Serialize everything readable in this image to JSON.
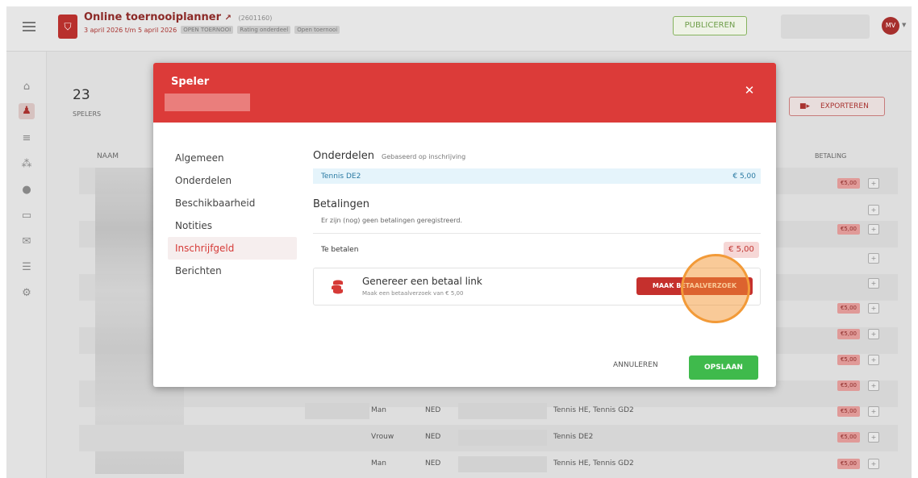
{
  "header": {
    "app_title": "Online toernooiplanner",
    "app_id": "(2601160)",
    "date_range": "3 april 2026 t/m 5 april 2026",
    "tags": [
      "OPEN TOERNOOI",
      "Rating onderdeel",
      "Open toernooi"
    ],
    "publish_label": "PUBLICEREN",
    "avatar_initials": "MV"
  },
  "sidebar": {
    "items": [
      {
        "icon": "home-icon",
        "glyph": "⌂"
      },
      {
        "icon": "players-icon",
        "glyph": "♟"
      },
      {
        "icon": "list-icon",
        "glyph": "≡"
      },
      {
        "icon": "bracket-icon",
        "glyph": "⁂"
      },
      {
        "icon": "ball-icon",
        "glyph": "●"
      },
      {
        "icon": "display-icon",
        "glyph": "▭"
      },
      {
        "icon": "mail-icon",
        "glyph": "✉"
      },
      {
        "icon": "stack-icon",
        "glyph": "☰"
      },
      {
        "icon": "settings-icon",
        "glyph": "⚙"
      }
    ]
  },
  "main": {
    "stat_count": "23",
    "stat_label": "SPELERS",
    "export_label": "EXPORTEREN",
    "col_naam": "NAAM",
    "col_betaling": "BETALING",
    "badge_amount": "€5,00",
    "rows": [
      {
        "gender": "Man",
        "country": "NED",
        "events": "Tennis HE, Tennis GD2"
      },
      {
        "gender": "Vrouw",
        "country": "NED",
        "events": "Tennis DE2"
      },
      {
        "gender": "Man",
        "country": "NED",
        "events": "Tennis HE, Tennis GD2"
      }
    ]
  },
  "modal": {
    "title": "Speler",
    "nav": [
      "Algemeen",
      "Onderdelen",
      "Beschikbaarheid",
      "Notities",
      "Inschrijfgeld",
      "Berichten"
    ],
    "active_nav": "Inschrijfgeld",
    "onderdelen_title": "Onderdelen",
    "onderdelen_hint": "Gebaseerd op inschrijving",
    "item_name": "Tennis DE2",
    "item_price": "€ 5,00",
    "betalingen_title": "Betalingen",
    "no_payments": "Er zijn (nog) geen betalingen geregistreerd.",
    "te_betalen_label": "Te betalen",
    "te_betalen_amount": "€ 5,00",
    "paylink_title": "Genereer een betaal link",
    "paylink_sub": "Maak een betaalverzoek van € 5,00",
    "paylink_button": "MAAK BETAALVERZOEK",
    "cancel_label": "ANNULEREN",
    "save_label": "OPSLAAN"
  },
  "colors": {
    "brand_red": "#dc3b39",
    "save_green": "#3fba4c",
    "touch_orange": "#f29a38"
  }
}
